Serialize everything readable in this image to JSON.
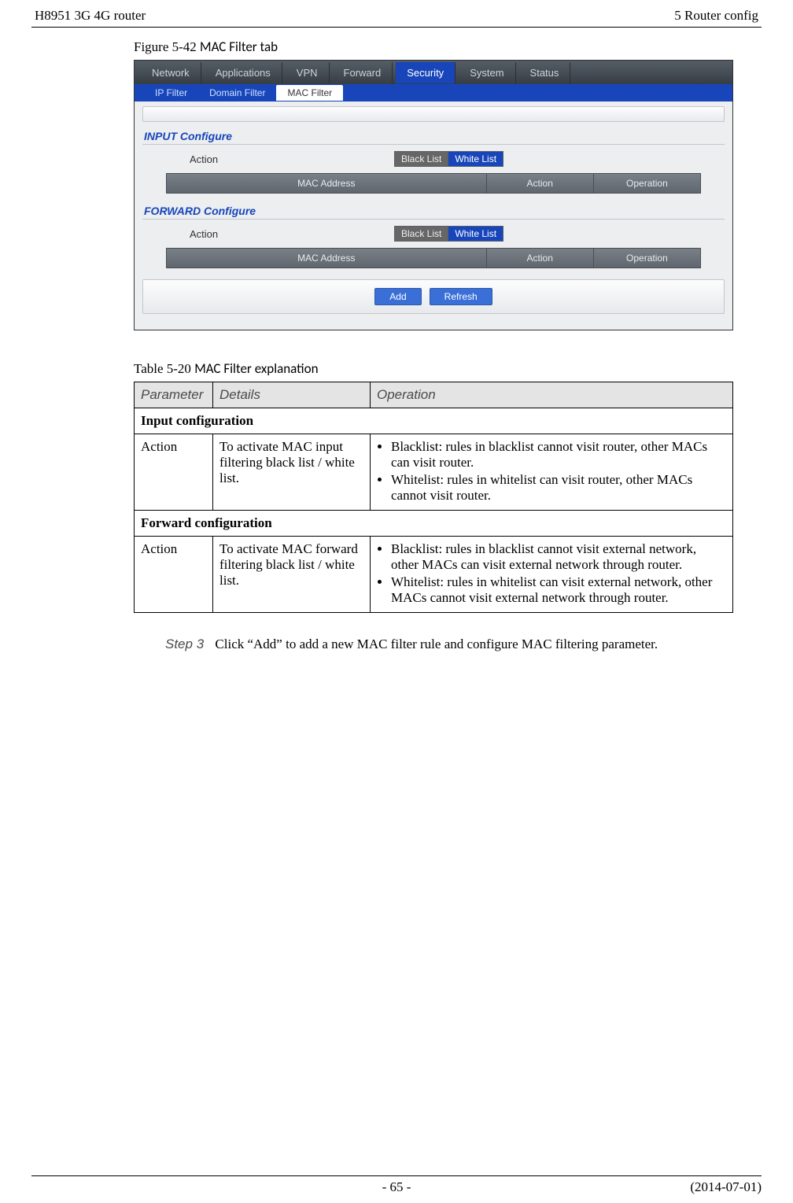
{
  "header": {
    "left": "H8951 3G 4G router",
    "right": "5  Router config"
  },
  "figure": {
    "caption_prefix": "Figure 5-42",
    "caption_title": "MAC Filter tab",
    "tabs": [
      "Network",
      "Applications",
      "VPN",
      "Forward",
      "Security",
      "System",
      "Status"
    ],
    "active_tab": "Security",
    "subtabs": [
      "IP Filter",
      "Domain Filter",
      "MAC Filter"
    ],
    "active_subtab": "MAC Filter",
    "sections": {
      "input": {
        "title": "INPUT Configure",
        "action_label": "Action",
        "black": "Black List",
        "white": "White List"
      },
      "forward": {
        "title": "FORWARD Configure",
        "action_label": "Action",
        "black": "Black List",
        "white": "White List"
      }
    },
    "grid_headers": {
      "mac": "MAC Address",
      "action": "Action",
      "operation": "Operation"
    },
    "buttons": {
      "add": "Add",
      "refresh": "Refresh"
    }
  },
  "table": {
    "caption_prefix": "Table 5-20",
    "caption_title": "MAC Filter explanation",
    "head": {
      "param": "Parameter",
      "details": "Details",
      "operation": "Operation"
    },
    "section_input": "Input configuration",
    "section_forward": "Forward configuration",
    "row_input": {
      "param": "Action",
      "details": "To activate MAC input filtering black list / white list.",
      "op1": "Blacklist: rules in blacklist cannot visit router, other MACs can visit router.",
      "op2": "Whitelist: rules in whitelist can visit router, other MACs cannot visit router."
    },
    "row_forward": {
      "param": "Action",
      "details": "To activate MAC forward filtering black list / white list.",
      "op1": "Blacklist: rules in blacklist cannot visit external network, other MACs can visit external network through router.",
      "op2": "Whitelist: rules in whitelist can visit external network, other MACs cannot visit external network through router."
    }
  },
  "step": {
    "label": "Step 3",
    "text": "Click “Add” to add a new MAC filter rule and configure MAC filtering parameter."
  },
  "footer": {
    "page": "- 65 -",
    "date": "(2014-07-01)"
  }
}
